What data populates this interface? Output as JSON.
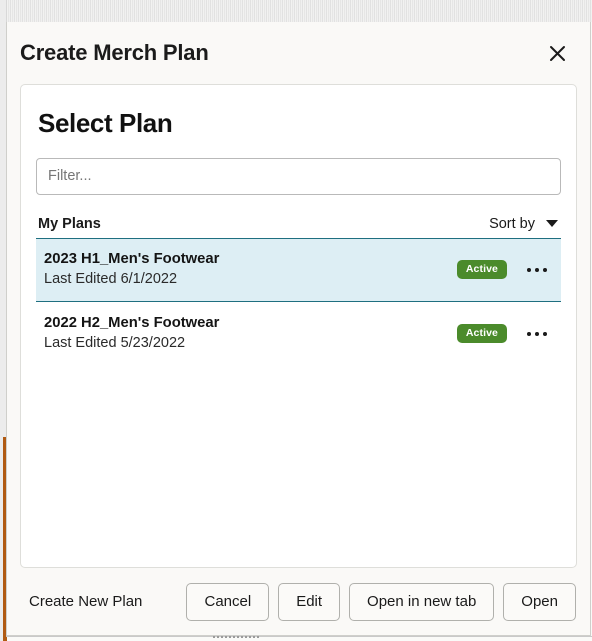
{
  "dialog": {
    "title": "Create Merch Plan",
    "close_icon": "close-icon",
    "close_label": "Close"
  },
  "card": {
    "heading": "Select Plan",
    "filter": {
      "placeholder": "Filter...",
      "value": ""
    },
    "list_header": {
      "label": "My Plans",
      "sort_label": "Sort by",
      "sort_icon": "chevron-down-icon"
    },
    "plans": [
      {
        "name": "2023 H1_Men's Footwear",
        "last_edited": "Last Edited 6/1/2022",
        "status": "Active",
        "selected": true,
        "menu_icon": "ellipsis-horizontal-icon"
      },
      {
        "name": "2022 H2_Men's Footwear",
        "last_edited": "Last Edited 5/23/2022",
        "status": "Active",
        "selected": false,
        "menu_icon": "ellipsis-horizontal-icon"
      }
    ]
  },
  "footer": {
    "create_new_plan": "Create New Plan",
    "buttons": [
      {
        "label": "Cancel",
        "name": "cancel-button"
      },
      {
        "label": "Edit",
        "name": "edit-button"
      },
      {
        "label": "Open in new tab",
        "name": "open-in-new-tab-button"
      },
      {
        "label": "Open",
        "name": "open-button"
      }
    ]
  },
  "colors": {
    "accent_teal": "#1f6f80",
    "selected_row_bg": "#ddeef4",
    "status_green": "#4b8b2b",
    "left_strip_orange": "#b05a12",
    "dialog_bg": "#faf9f7"
  }
}
